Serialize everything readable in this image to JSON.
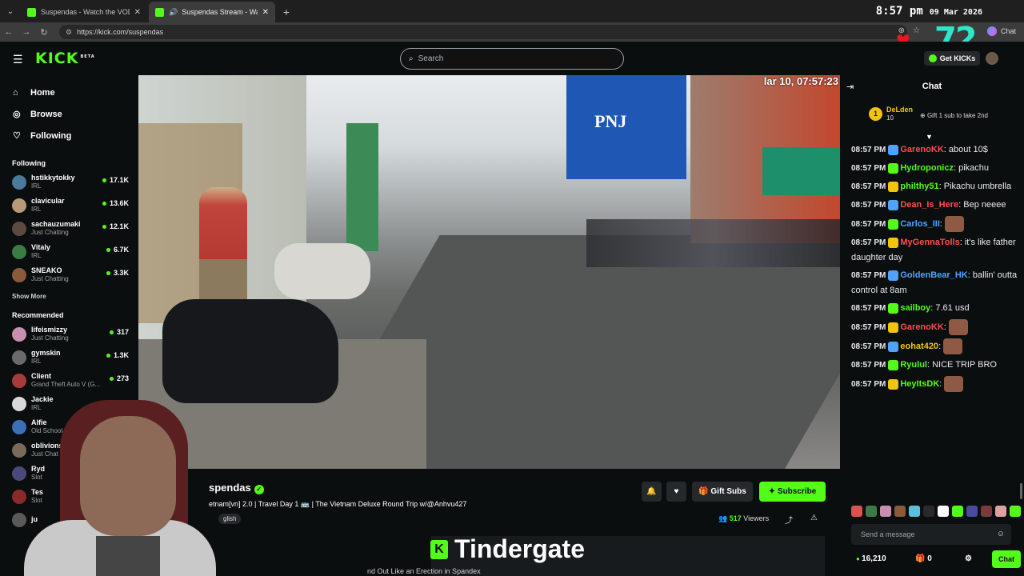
{
  "browser": {
    "tabs": [
      {
        "title": "Suspendas - Watch the VOD on Kick",
        "active": false,
        "audio": false
      },
      {
        "title": "Suspendas Stream - Watch Live on Kick",
        "active": true,
        "audio": true
      }
    ],
    "new_tab": "+",
    "url": "https://kick.com/suspendas",
    "chat_button": "Chat"
  },
  "overlay": {
    "time": "8:57 pm",
    "date": "09 Mar 2026",
    "counter": "72"
  },
  "header": {
    "logo": "KICK",
    "logo_badge": "BETA",
    "search_placeholder": "Search",
    "get_kicks": "Get KICKs"
  },
  "sidebar": {
    "nav": [
      {
        "label": "Home",
        "icon": "home-icon"
      },
      {
        "label": "Browse",
        "icon": "compass-icon"
      },
      {
        "label": "Following",
        "icon": "heart-icon"
      }
    ],
    "following_title": "Following",
    "following": [
      {
        "name": "hstikkytokky",
        "category": "IRL",
        "viewers": "17.1K",
        "color": "#4a7a9c"
      },
      {
        "name": "clavicular",
        "category": "IRL",
        "viewers": "13.6K",
        "color": "#b89a78"
      },
      {
        "name": "sachauzumaki",
        "category": "Just Chatting",
        "viewers": "12.1K",
        "color": "#5b4a3f"
      },
      {
        "name": "Vitaly",
        "category": "IRL",
        "viewers": "6.7K",
        "color": "#3a7d44"
      },
      {
        "name": "SNEAKO",
        "category": "Just Chatting",
        "viewers": "3.3K",
        "color": "#8a5a3a"
      }
    ],
    "show_more": "Show More",
    "recommended_title": "Recommended",
    "recommended": [
      {
        "name": "lifeismizzy",
        "category": "Just Chatting",
        "viewers": "317",
        "color": "#c98fb0"
      },
      {
        "name": "gymskin",
        "category": "IRL",
        "viewers": "1.3K",
        "color": "#6a6a6a"
      },
      {
        "name": "Client",
        "category": "Grand Theft Auto V (G...",
        "viewers": "273",
        "color": "#a83a3a"
      },
      {
        "name": "Jackie",
        "category": "IRL",
        "viewers": "",
        "color": "#d9d9d9"
      },
      {
        "name": "Alfie",
        "category": "Old School Ru",
        "viewers": "",
        "color": "#3b6fb6"
      },
      {
        "name": "oblivionsw",
        "category": "Just Chat",
        "viewers": "",
        "color": "#7a6a5a"
      },
      {
        "name": "Ryd",
        "category": "Slot",
        "viewers": "",
        "color": "#4a4a7a"
      },
      {
        "name": "Tes",
        "category": "Slot",
        "viewers": "",
        "color": "#8a2a2a"
      },
      {
        "name": "ju",
        "category": "",
        "viewers": "",
        "color": "#5a5a5a"
      }
    ]
  },
  "video": {
    "timestamp": "lar 10, 07:57:23"
  },
  "stream": {
    "name": "spendas",
    "title": "etnam[vn] 2.0 | Travel Day 1 🚌 | The Vietnam Deluxe Round Trip w/@Anhvu427",
    "language": "glish",
    "gift_subs": "Gift Subs",
    "subscribe": "Subscribe",
    "viewers": "517",
    "viewers_label": "Viewers",
    "banner_text": "Tindergate",
    "ticker": "nd Out Like an Erection in Spandex"
  },
  "chat": {
    "title": "Chat",
    "pinned": {
      "rank": "1",
      "name": "DeLden",
      "count": "10",
      "gift": "Gift 1 sub to take 2nd"
    },
    "messages": [
      {
        "time": "08:57 PM",
        "user": "GarenoKK",
        "color": "#ff4d4d",
        "text": ": about 10$"
      },
      {
        "time": "08:57 PM",
        "user": "Hydroponicz",
        "color": "#53fc18",
        "text": ": pikachu"
      },
      {
        "time": "08:57 PM",
        "user": "philthy51",
        "color": "#53fc18",
        "text": ": Pikachu umbrella"
      },
      {
        "time": "08:57 PM",
        "user": "Dean_Is_Here",
        "color": "#ff4d4d",
        "text": ": Bep neeee"
      },
      {
        "time": "08:57 PM",
        "user": "Carlos_III",
        "color": "#4fa3ff",
        "text": ":"
      },
      {
        "time": "08:57 PM",
        "user": "MyGennaTolls",
        "color": "#ff4d4d",
        "text": ": it's like father daughter day"
      },
      {
        "time": "08:57 PM",
        "user": "GoldenBear_HK",
        "color": "#4fa3ff",
        "text": ": ballin' outta control at 8am"
      },
      {
        "time": "08:57 PM",
        "user": "sailboy",
        "color": "#53fc18",
        "text": ": 7.61 usd"
      },
      {
        "time": "08:57 PM",
        "user": "GarenoKK",
        "color": "#ff4d4d",
        "text": ":"
      },
      {
        "time": "08:57 PM",
        "user": "eohat420",
        "color": "#f1c40f",
        "text": ":"
      },
      {
        "time": "08:57 PM",
        "user": "Ryulul",
        "color": "#53fc18",
        "text": ": NICE TRIP BRO"
      },
      {
        "time": "08:57 PM",
        "user": "HeyItsDK",
        "color": "#53fc18",
        "text": ":"
      }
    ],
    "input_placeholder": "Send a message",
    "kicks": "16,210",
    "gifts": "0",
    "send": "Chat"
  }
}
